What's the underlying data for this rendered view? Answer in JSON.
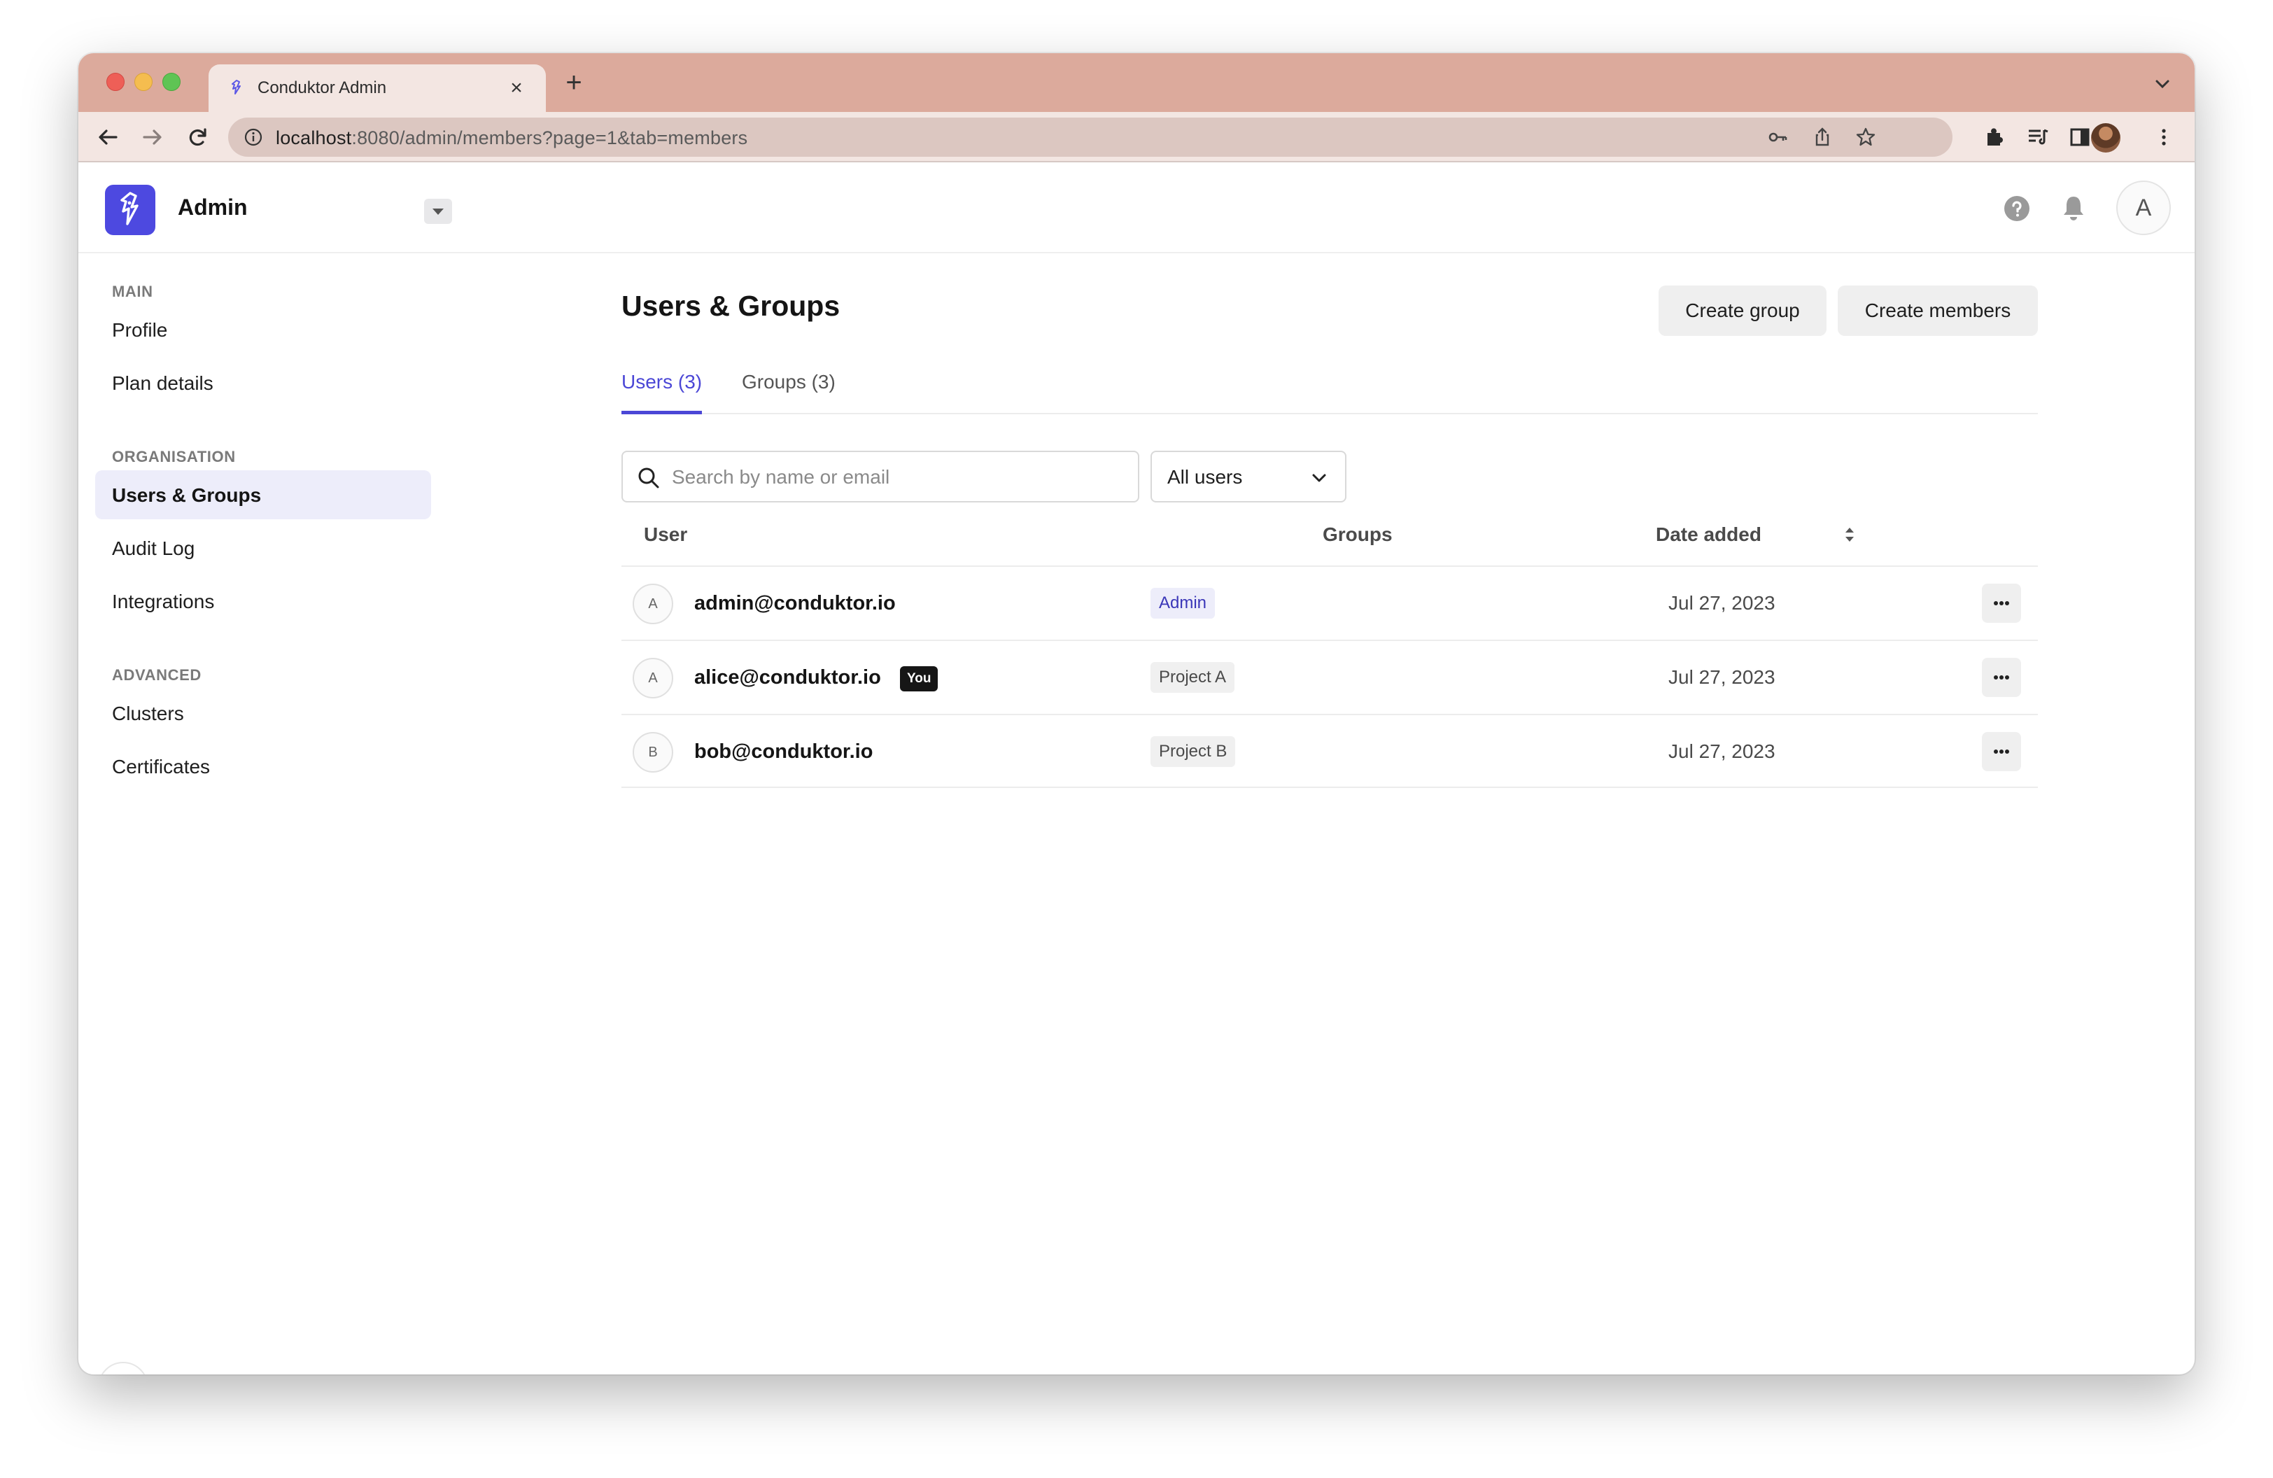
{
  "browser": {
    "tab_title": "Conduktor Admin",
    "url_host": "localhost",
    "url_rest": ":8080/admin/members?page=1&tab=members"
  },
  "header": {
    "app_name": "Admin",
    "avatar_letter": "A"
  },
  "sidebar": {
    "sections": [
      {
        "title": "MAIN",
        "items": [
          "Profile",
          "Plan details"
        ]
      },
      {
        "title": "ORGANISATION",
        "items": [
          "Users & Groups",
          "Audit Log",
          "Integrations"
        ]
      },
      {
        "title": "ADVANCED",
        "items": [
          "Clusters",
          "Certificates"
        ]
      }
    ],
    "active_item": "Users & Groups"
  },
  "main": {
    "title": "Users & Groups",
    "create_group_label": "Create group",
    "create_members_label": "Create members",
    "tabs": [
      {
        "label": "Users (3)",
        "active": true
      },
      {
        "label": "Groups (3)",
        "active": false
      }
    ],
    "search_placeholder": "Search by name or email",
    "filter_value": "All users",
    "columns": [
      "User",
      "Groups",
      "Date added"
    ],
    "rows": [
      {
        "initial": "A",
        "email": "admin@conduktor.io",
        "badge": "",
        "group": "Admin",
        "date": "Jul 27, 2023"
      },
      {
        "initial": "A",
        "email": "alice@conduktor.io",
        "badge": "You",
        "group": "Project A",
        "date": "Jul 27, 2023"
      },
      {
        "initial": "B",
        "email": "bob@conduktor.io",
        "badge": "",
        "group": "Project B",
        "date": "Jul 27, 2023"
      }
    ]
  },
  "colors": {
    "accent": "#4b47d6",
    "logo": "#4d49e0",
    "tabstrip": "#dcaa9c"
  }
}
